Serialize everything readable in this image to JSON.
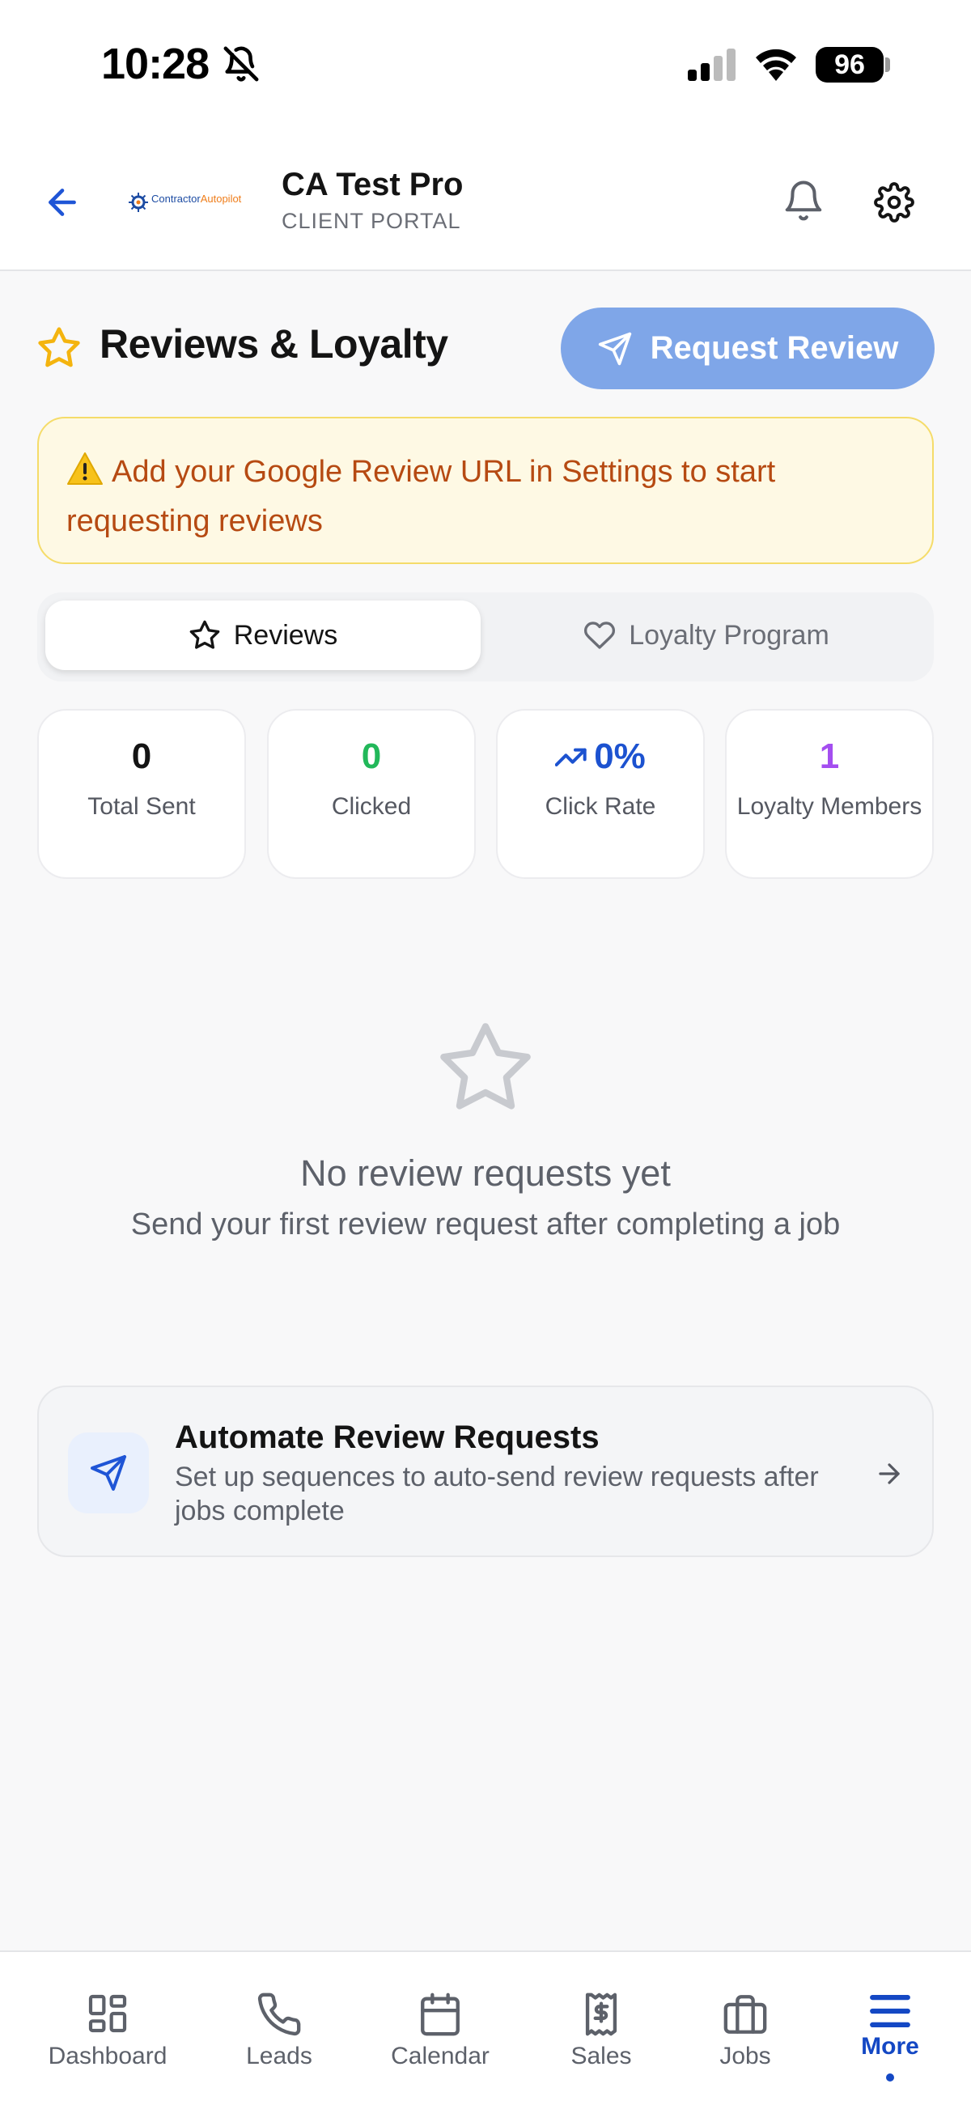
{
  "status_bar": {
    "time": "10:28",
    "battery": "96"
  },
  "header": {
    "company_name": "CA Test Pro",
    "portal_label": "CLIENT PORTAL",
    "logo_brand_a": "Contractor",
    "logo_brand_b": "Autopilot"
  },
  "page": {
    "title": "Reviews & Loyalty",
    "request_button": "Request Review"
  },
  "warning": {
    "text": "Add your Google Review URL in Settings to start requesting reviews"
  },
  "tabs": [
    {
      "label": "Reviews",
      "active": true
    },
    {
      "label": "Loyalty Program",
      "active": false
    }
  ],
  "stats": [
    {
      "value": "0",
      "label": "Total Sent",
      "color": "#141414"
    },
    {
      "value": "0",
      "label": "Clicked",
      "color": "#22b85a"
    },
    {
      "value": "0%",
      "label": "Click Rate",
      "color": "#1c52d0"
    },
    {
      "value": "1",
      "label": "Loyalty Members",
      "color": "#a44ef0"
    }
  ],
  "empty_state": {
    "title": "No review requests yet",
    "subtitle": "Send your first review request after completing a job"
  },
  "automate": {
    "title": "Automate Review Requests",
    "description": "Set up sequences to auto-send review requests after jobs complete"
  },
  "bottom_nav": [
    {
      "label": "Dashboard",
      "icon": "dashboard-icon"
    },
    {
      "label": "Leads",
      "icon": "phone-icon"
    },
    {
      "label": "Calendar",
      "icon": "calendar-icon"
    },
    {
      "label": "Sales",
      "icon": "receipt-icon"
    },
    {
      "label": "Jobs",
      "icon": "briefcase-icon"
    },
    {
      "label": "More",
      "icon": "menu-icon",
      "active": true
    }
  ],
  "colors": {
    "accent": "#1448c4",
    "request_button": "#7fa6e8",
    "warning_text": "#b64a12",
    "warning_bg": "#fef9e4"
  }
}
